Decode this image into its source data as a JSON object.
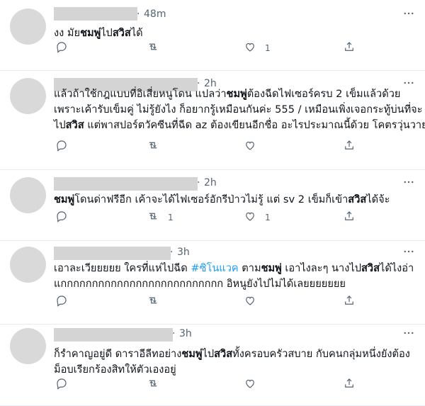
{
  "tweets": [
    {
      "time": "48m",
      "lines": [
        [
          {
            "t": "งง มัย"
          },
          {
            "t": "ชมพู่",
            "b": true
          },
          {
            "t": "ไป"
          },
          {
            "t": "สวิส",
            "b": true
          },
          {
            "t": "ได้"
          }
        ]
      ],
      "reply_count": "",
      "retweet_count": "",
      "like_count": "1"
    },
    {
      "time": "2h",
      "lines": [
        [
          {
            "t": "แล้วถ้าใช้กฎแบบที่อิเสี่ยหนูโดน แปลว่า"
          },
          {
            "t": "ชมพู่",
            "b": true
          },
          {
            "t": "ต้องฉีดไฟเซอร์ครบ 2 เข็มแล้วด้วย"
          }
        ],
        [
          {
            "t": "เพราะเค้ารับเข็มคู่ ไม่รู้ยังไง ก็อยากรู้เหมือนกันค่ะ 555 / เหมือนเพิ่งเจอกระทู้บ่นที่จะ"
          }
        ],
        [
          {
            "t": "ไป"
          },
          {
            "t": "สวิส",
            "b": true
          },
          {
            "t": " แต่พาสปอร์ตวัคซีนที่ฉีด az ต้องเขียนอีกชื่อ อะไรประมาณนี้ด้วย โคตรวุ่นวาย"
          }
        ]
      ],
      "reply_count": "",
      "retweet_count": "",
      "like_count": ""
    },
    {
      "time": "2h",
      "lines": [
        [
          {
            "t": "ชมพู่",
            "b": true
          },
          {
            "t": "โดนด่าฟรีอีก เค้าจะได้ไฟเซอร์อักรีป่าวไม่รู้ แต่ sv 2 เข็มก็เข้า"
          },
          {
            "t": "สวิส",
            "b": true
          },
          {
            "t": "ได้จ้ะ"
          }
        ]
      ],
      "reply_count": "",
      "retweet_count": "1",
      "like_count": "1"
    },
    {
      "time": "3h",
      "lines": [
        [
          {
            "t": "เอาละเวียยยยย ใครที่แห่ไปฉีด "
          },
          {
            "t": "#ซิโนแวค",
            "h": true
          },
          {
            "t": " ตาม"
          },
          {
            "t": "ชมพู่",
            "b": true
          },
          {
            "t": " เอาไงละๆ นางไป"
          },
          {
            "t": "สวิส",
            "b": true
          },
          {
            "t": "ได้ไงอ่า"
          }
        ],
        [
          {
            "t": "แกกกกกกกกกกกกกกกกกกกกกกกกกก อิหนูยังไปไม่ได้เลยยยยยยย"
          }
        ]
      ],
      "reply_count": "",
      "retweet_count": "",
      "like_count": ""
    },
    {
      "time": "3h",
      "lines": [
        [
          {
            "t": "ก็รำคาญอยู่ดี ดาราอีลีทอย่าง"
          },
          {
            "t": "ชมพู่",
            "b": true
          },
          {
            "t": "ไป"
          },
          {
            "t": "สวิส",
            "b": true
          },
          {
            "t": "ทั้งครอบครัวสบาย กับคนกลุ่มหนึ่งยังต้อง"
          }
        ],
        [
          {
            "t": "ม็อบเรียกร้องสิทให้ตัวเองอยู่"
          }
        ]
      ],
      "reply_count": "",
      "retweet_count": "",
      "like_count": ""
    }
  ],
  "separator": "·",
  "icons": {
    "reply": "reply-icon",
    "retweet": "retweet-icon",
    "like": "like-icon",
    "share": "share-icon",
    "more": "more-icon"
  }
}
